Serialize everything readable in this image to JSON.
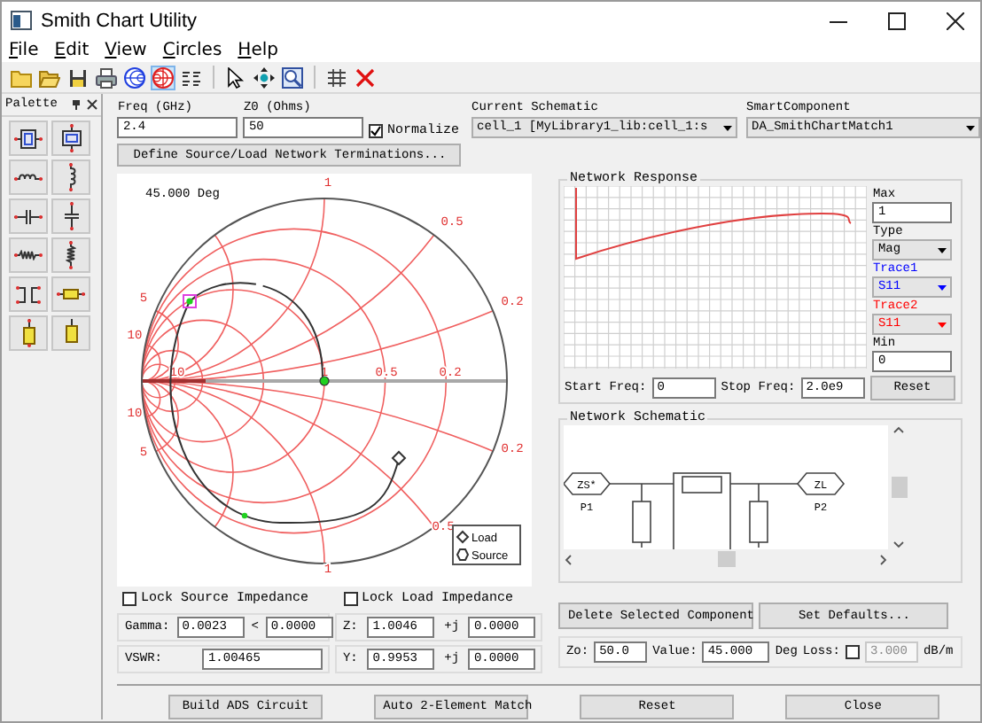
{
  "window": {
    "title": "Smith Chart Utility"
  },
  "menu": [
    "File",
    "Edit",
    "View",
    "Circles",
    "Help"
  ],
  "toolbar": [
    {
      "kind": "new",
      "selected": false
    },
    {
      "kind": "open",
      "selected": false
    },
    {
      "kind": "save",
      "selected": false
    },
    {
      "kind": "print",
      "selected": false
    },
    {
      "kind": "impedance-chart",
      "selected": false
    },
    {
      "kind": "admittance-chart",
      "selected": true
    },
    {
      "kind": "chart-labels",
      "selected": false
    },
    {
      "kind": "select",
      "selected": false
    },
    {
      "kind": "pan",
      "selected": false
    },
    {
      "kind": "zoom",
      "selected": false
    },
    {
      "kind": "tune",
      "selected": false
    },
    {
      "kind": "delete",
      "selected": false
    }
  ],
  "palette": {
    "title": "Palette",
    "items": [
      {
        "kind": "tline-series"
      },
      {
        "kind": "tline-shunt"
      },
      {
        "kind": "inductor-series"
      },
      {
        "kind": "inductor-shunt"
      },
      {
        "kind": "capacitor-series"
      },
      {
        "kind": "capacitor-shunt"
      },
      {
        "kind": "resistor-series"
      },
      {
        "kind": "resistor-shunt"
      },
      {
        "kind": "transformer"
      },
      {
        "kind": "line-series"
      },
      {
        "kind": "stub-open"
      },
      {
        "kind": "stub-short"
      }
    ]
  },
  "settings": {
    "freq_label": "Freq (GHz)",
    "freq": "2.4",
    "z0_label": "Z0 (Ohms)",
    "z0": "50",
    "normalize": {
      "label": "Normalize",
      "checked": true
    },
    "schematic_label": "Current Schematic",
    "schematic": "cell_1 [MyLibrary1_lib:cell_1:s",
    "component_label": "SmartComponent",
    "component": "DA_SmithChartMatch1"
  },
  "define_button": "Define Source/Load Network Terminations...",
  "smith_chart": {
    "angle": "45.000 Deg",
    "labels": [
      "1",
      "0.5",
      "0.2",
      "5",
      "10",
      "10",
      "1",
      "0.5",
      "0.2",
      "10",
      "5",
      "0.2",
      "0.5",
      "1"
    ],
    "legend": [
      {
        "kind": "load",
        "label": "Load"
      },
      {
        "kind": "source",
        "label": "Source"
      }
    ]
  },
  "network_response": {
    "title": "Network Response",
    "max_label": "Max",
    "max": "1",
    "type_label": "Type",
    "type": "Mag",
    "traces": [
      {
        "label": "Trace1",
        "value": "S11",
        "color": "#0000ff"
      },
      {
        "label": "Trace2",
        "value": "S11",
        "color": "#ff0000"
      }
    ],
    "min_label": "Min",
    "min": "0",
    "start_label": "Start Freq:",
    "start": "0",
    "stop_label": "Stop Freq:",
    "stop": "2.0e9",
    "reset": "Reset"
  },
  "network_schematic": {
    "title": "Network Schematic",
    "ports": [
      {
        "label": "ZS*",
        "name": "P1"
      },
      {
        "label": "ZL",
        "name": "P2"
      }
    ]
  },
  "locks": [
    {
      "label": "Lock Source Impedance",
      "checked": false
    },
    {
      "label": "Lock Load Impedance",
      "checked": false
    }
  ],
  "gamma": {
    "label": "Gamma:",
    "magnitude": "0.0023",
    "angle_sign": "<",
    "angle": "0.0000"
  },
  "z": {
    "label": "Z:",
    "real": "1.0046",
    "j": "+j",
    "imag": "0.0000"
  },
  "vswr": {
    "label": "VSWR:",
    "value": "1.00465"
  },
  "y": {
    "label": "Y:",
    "real": "0.9953",
    "j": "+j",
    "imag": "0.0000"
  },
  "component_buttons": [
    "Delete Selected Component",
    "Set Defaults..."
  ],
  "component": {
    "zo_label": "Zo:",
    "zo": "50.0",
    "value_label": "Value:",
    "value": "45.000",
    "unit": "Deg",
    "loss_label": "Loss:",
    "loss": {
      "checked": false,
      "disabled": true,
      "value": "3.000"
    },
    "loss_unit": "dB/m"
  },
  "buttons": [
    "Build ADS Circuit",
    "Auto 2-Element Match",
    "Reset",
    "Close"
  ]
}
